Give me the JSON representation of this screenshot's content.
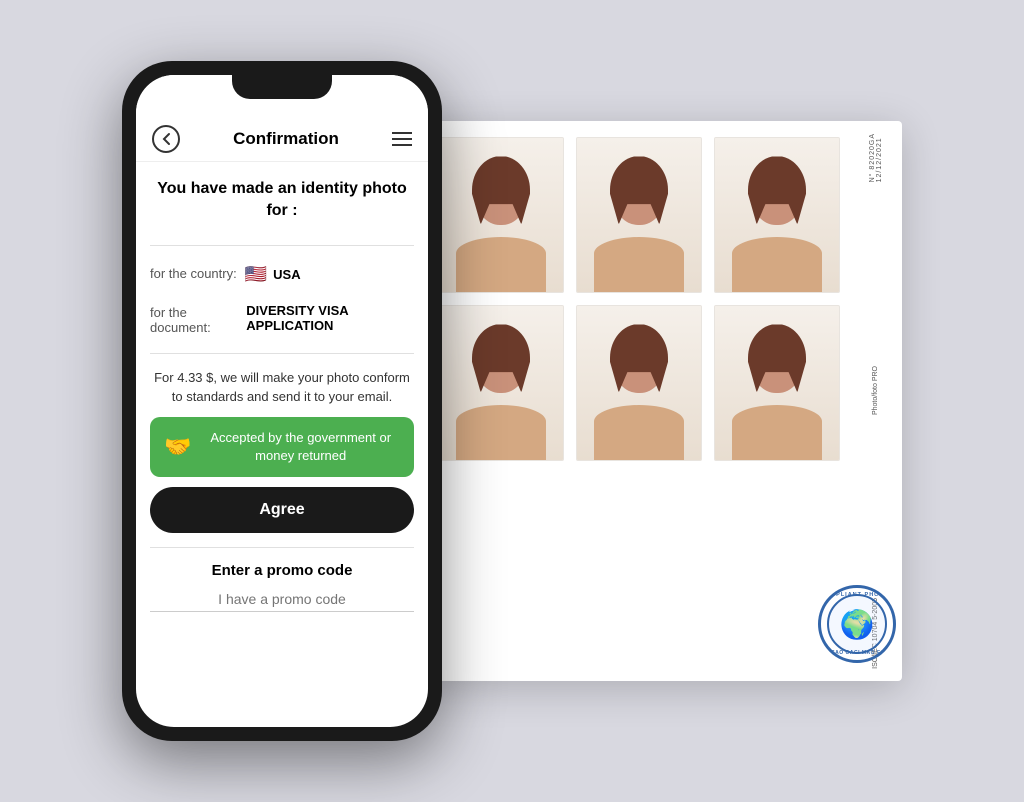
{
  "phone": {
    "nav": {
      "title": "Confirmation",
      "back_label": "←",
      "menu_label": "menu"
    },
    "headline": "You have made an identity photo for :",
    "country_label": "for the country:",
    "country_value": "USA",
    "country_flag": "🇺🇸",
    "document_label": "for the document:",
    "document_value": "DIVERSITY VISA APPLICATION",
    "price_text": "For 4.33 $, we will make your photo conform to standards and send it to your email.",
    "guarantee_text": "Accepted by the government or money returned",
    "agree_label": "Agree",
    "promo_title": "Enter a promo code",
    "promo_placeholder": "I have a promo code"
  },
  "photo_print": {
    "number": "N° 82020GA",
    "date": "12/12/2021",
    "brand": "Photo/foto PRO",
    "standard": "ISO/IEC 10704 5-2005",
    "stamp_top": "COMPLIANT PHOTOS",
    "stamp_bottom": "ICAO OACI MAO FO"
  },
  "colors": {
    "green": "#4caf50",
    "dark": "#1a1a1a",
    "stamp_blue": "#3366aa"
  }
}
